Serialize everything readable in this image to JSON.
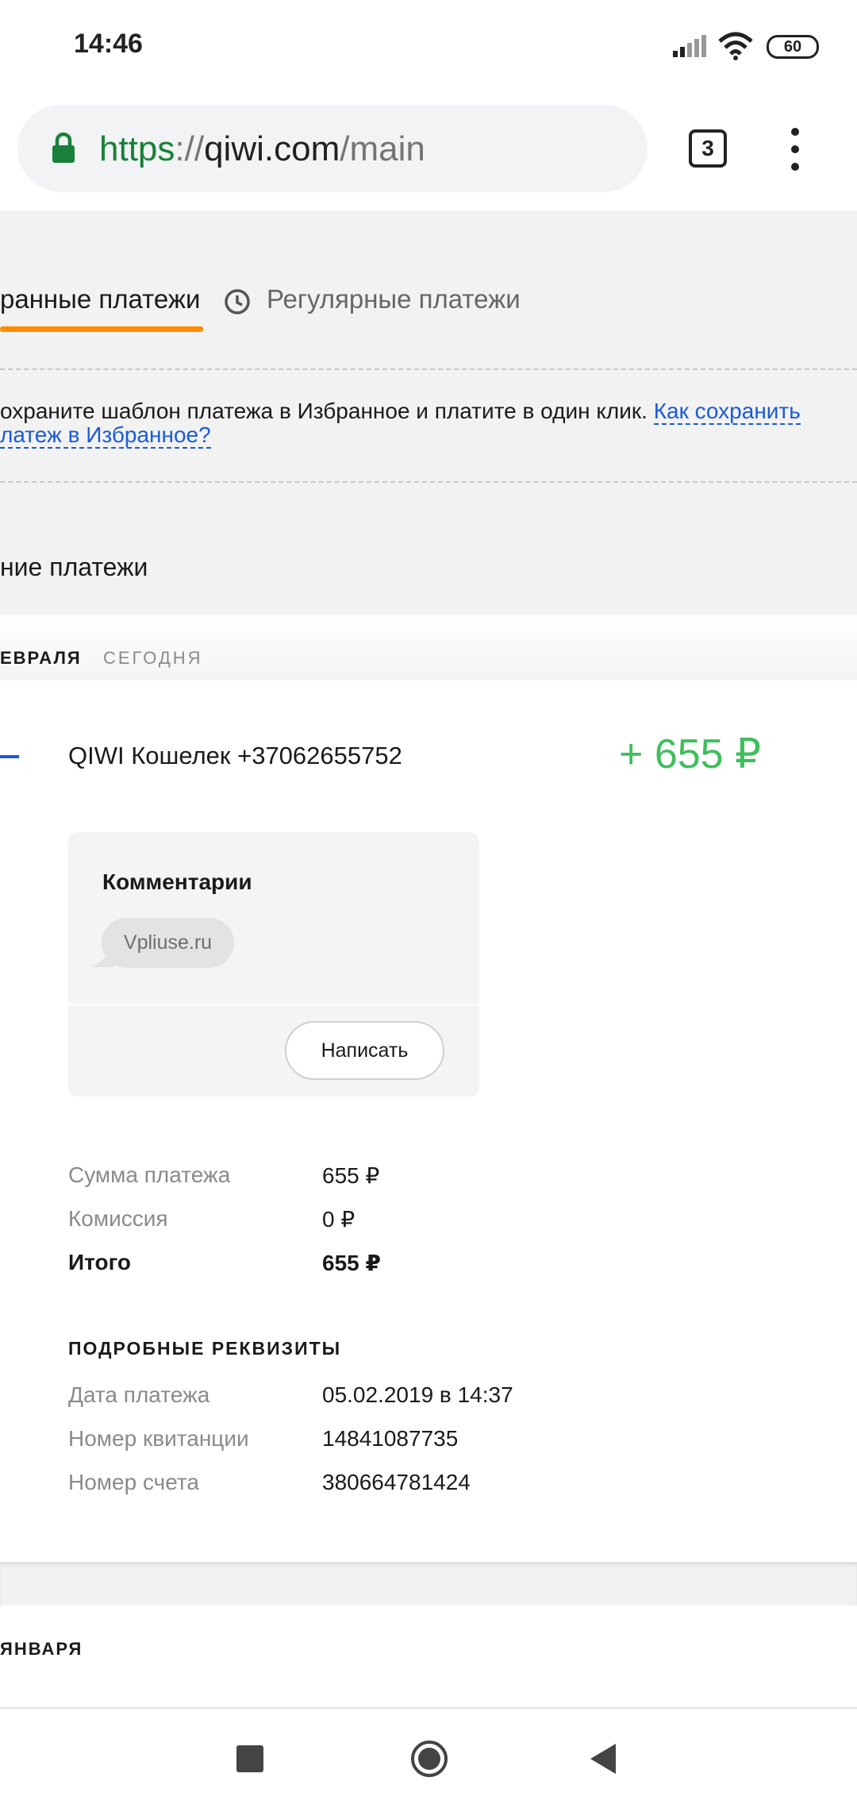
{
  "status_bar": {
    "time": "14:46",
    "battery": "60"
  },
  "browser": {
    "url_scheme": "https",
    "url_sep": "://",
    "url_host": "qiwi.com",
    "url_path": "/main",
    "tab_count": "3"
  },
  "tabs": {
    "favorites": "ранные платежи",
    "regular": "Регулярные платежи"
  },
  "hint": {
    "text": "охраните шаблон платежа в Избранное и платите в один клик. ",
    "link": "Как сохранить латеж в Избранное?"
  },
  "section_title": "ние платежи",
  "date_group": {
    "date": "ЕВРАЛЯ",
    "relative": "СЕГОДНЯ"
  },
  "payment": {
    "payee": "QIWI Кошелек +37062655752",
    "amount": "+ 655 ₽",
    "comments_title": "Комментарии",
    "comment": "Vpliuse.ru",
    "write_label": "Написать",
    "summary": [
      {
        "label": "Сумма платежа",
        "value": "655 ₽"
      },
      {
        "label": "Комиссия",
        "value": "0 ₽"
      },
      {
        "label": "Итого",
        "value": "655 ₽"
      }
    ],
    "details_heading": "ПОДРОБНЫЕ РЕКВИЗИТЫ",
    "details": [
      {
        "label": "Дата платежа",
        "value": "05.02.2019 в 14:37"
      },
      {
        "label": "Номер квитанции",
        "value": "14841087735"
      },
      {
        "label": "Номер счета",
        "value": "380664781424"
      }
    ]
  },
  "next_group": {
    "date": "ЯНВАРЯ"
  },
  "colors": {
    "accent": "#ff8c00",
    "positive": "#3fbe5c",
    "link": "#1a5bd6",
    "secure": "#188038"
  }
}
